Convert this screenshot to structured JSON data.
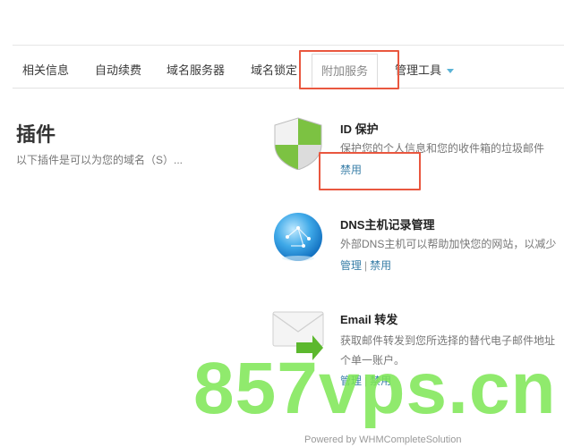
{
  "tabs": [
    {
      "label": "相关信息"
    },
    {
      "label": "自动续费"
    },
    {
      "label": "域名服务器"
    },
    {
      "label": "域名锁定"
    },
    {
      "label": "附加服务",
      "active": true
    },
    {
      "label": "管理工具",
      "has_dropdown": true
    }
  ],
  "plugins": {
    "title": "插件",
    "description": "以下插件是可以为您的域名（S）..."
  },
  "items": [
    {
      "title": "ID 保护",
      "description": "保护您的个人信息和您的收件箱的垃圾邮件",
      "links": [
        "禁用"
      ]
    },
    {
      "title": "DNS主机记录管理",
      "description": "外部DNS主机可以帮助加快您的网站，以减少",
      "links": [
        "管理",
        "禁用"
      ]
    },
    {
      "title": "Email 转发",
      "description": "获取邮件转发到您所选择的替代电子邮件地址",
      "description2": "个单一账户。",
      "links": [
        "管理",
        "禁用"
      ]
    }
  ],
  "watermark": "857vps.cn",
  "footer_partial": "Powered by WHMCompleteSolution",
  "colors": {
    "highlight": "#e9573f",
    "link": "#3a7fa8",
    "watermark": "#7ce654",
    "caret": "#5ab3d6"
  }
}
